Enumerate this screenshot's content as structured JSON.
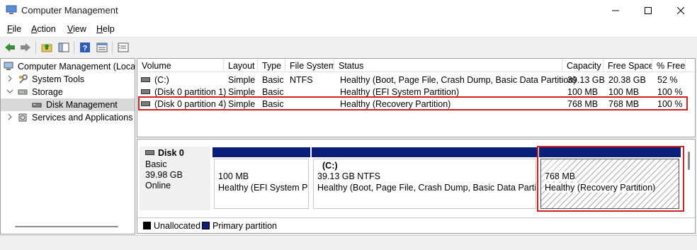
{
  "window": {
    "title": "Computer Management",
    "controls": {
      "minimize": "minimize-icon",
      "maximize": "maximize-icon",
      "close": "close-icon"
    }
  },
  "menu": [
    {
      "label": "File",
      "accel": "F",
      "rest": "ile"
    },
    {
      "label": "Action",
      "accel": "A",
      "rest": "ction"
    },
    {
      "label": "View",
      "accel": "V",
      "rest": "iew"
    },
    {
      "label": "Help",
      "accel": "H",
      "rest": "elp"
    }
  ],
  "toolbar": [
    "back-arrow-icon",
    "forward-arrow-icon",
    "up-folder-icon",
    "show-hide-tree-icon",
    "help-icon",
    "properties-icon",
    "export-list-icon"
  ],
  "tree": {
    "root": "Computer Management (Local",
    "items": [
      {
        "label": "System Tools"
      },
      {
        "label": "Storage"
      },
      {
        "label": "Disk Management"
      },
      {
        "label": "Services and Applications"
      }
    ]
  },
  "volume_list": {
    "columns": [
      "Volume",
      "Layout",
      "Type",
      "File System",
      "Status",
      "Capacity",
      "Free Space",
      "% Free"
    ],
    "rows": [
      {
        "volume": "(C:)",
        "layout": "Simple",
        "type": "Basic",
        "fs": "NTFS",
        "status": "Healthy (Boot, Page File, Crash Dump, Basic Data Partition)",
        "capacity": "39.13 GB",
        "free": "20.38 GB",
        "pct": "52 %"
      },
      {
        "volume": "(Disk 0 partition 1)",
        "layout": "Simple",
        "type": "Basic",
        "fs": "",
        "status": "Healthy (EFI System Partition)",
        "capacity": "100 MB",
        "free": "100 MB",
        "pct": "100 %"
      },
      {
        "volume": "(Disk 0 partition 4)",
        "layout": "Simple",
        "type": "Basic",
        "fs": "",
        "status": "Healthy (Recovery Partition)",
        "capacity": "768 MB",
        "free": "768 MB",
        "pct": "100 %"
      }
    ]
  },
  "disk": {
    "name": "Disk 0",
    "type": "Basic",
    "size": "39.98 GB",
    "state": "Online",
    "partitions": [
      {
        "name": "",
        "size": "100 MB",
        "status": "Healthy (EFI System Par"
      },
      {
        "name": "(C:)",
        "size": "39.13 GB NTFS",
        "status": "Healthy (Boot, Page File, Crash Dump, Basic Data Partition"
      },
      {
        "name": "",
        "size": "768 MB",
        "status": "Healthy (Recovery Partition)"
      }
    ]
  },
  "legend": [
    {
      "label": "Unallocated",
      "color": "#000000"
    },
    {
      "label": "Primary partition",
      "color": "#0a1f7a"
    }
  ],
  "colors": {
    "highlight": "#d42020",
    "partition_bar": "#0a1f7a"
  }
}
